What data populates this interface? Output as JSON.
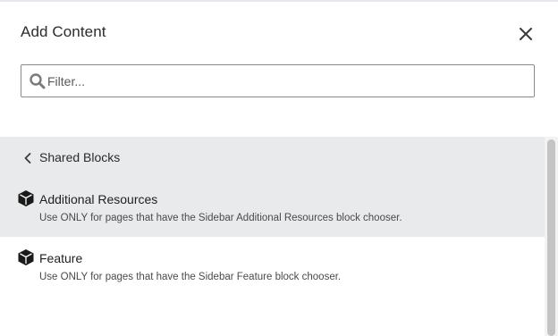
{
  "dialog": {
    "title": "Add Content",
    "close_icon": "close-icon"
  },
  "filter": {
    "placeholder": "Filter...",
    "value": "",
    "icon": "search-icon"
  },
  "back": {
    "label": "Shared Blocks",
    "icon": "chevron-left-icon"
  },
  "items": [
    {
      "name": "Additional Resources",
      "description": "Use ONLY for pages that have the Sidebar Additional Resources block chooser.",
      "icon": "cube-icon",
      "highlighted": true
    },
    {
      "name": "Feature",
      "description": "Use ONLY for pages that have the Sidebar Feature block chooser.",
      "icon": "cube-icon",
      "highlighted": false
    }
  ],
  "colors": {
    "panel_highlight": "#e9eaec",
    "icon": "#1a1a1a",
    "search_icon": "#7a7a7a",
    "border": "#8a8a8a"
  }
}
